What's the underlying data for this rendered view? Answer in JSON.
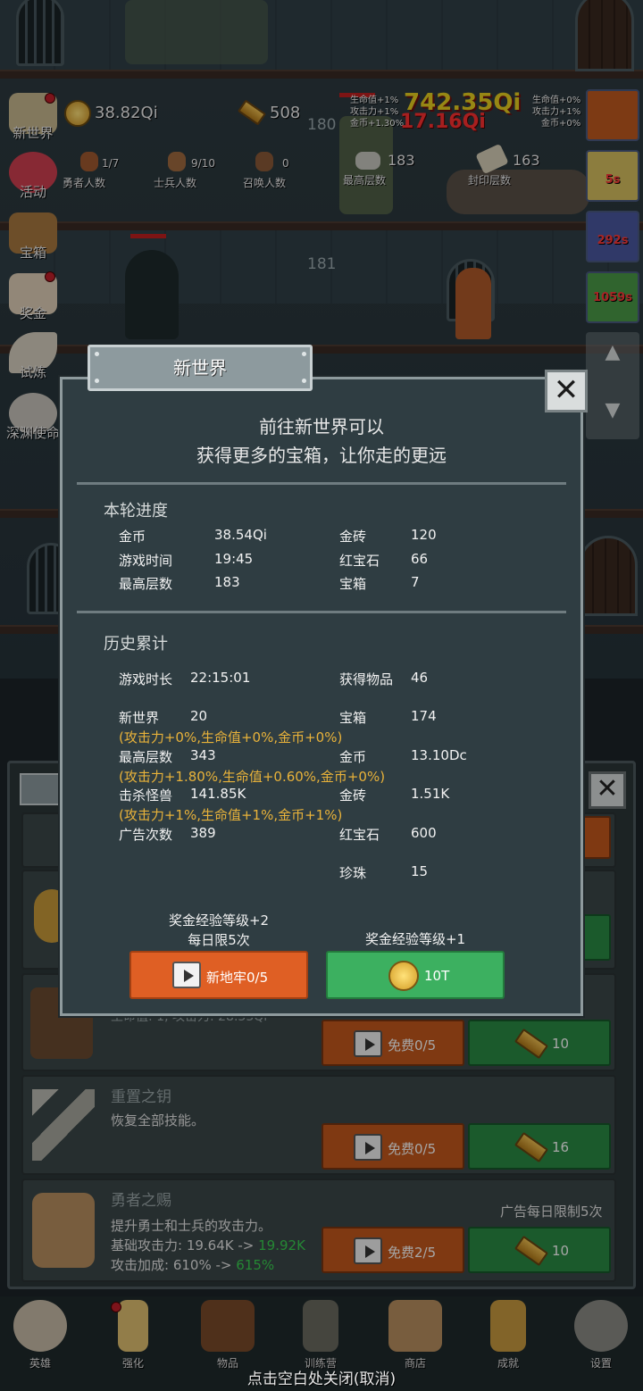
{
  "top": {
    "gold": "38.82Qi",
    "gold_bars": "508",
    "lane_numbers": [
      "180",
      "181"
    ],
    "counts": [
      {
        "value": "1/7",
        "label": "勇者人数"
      },
      {
        "value": "9/10",
        "label": "士兵人数"
      },
      {
        "value": "0",
        "label": "召唤人数"
      },
      {
        "value": "183",
        "label": "最高层数"
      },
      {
        "value": "163",
        "label": "封印层数"
      }
    ],
    "buff_left": [
      "生命值+1%",
      "攻击力+1%",
      "金币+1.30%"
    ],
    "buff_right": [
      "生命值+0%",
      "攻击力+1%",
      "金币+0%"
    ],
    "damage_popups": [
      "742.35Qi",
      "17.16Qi"
    ]
  },
  "side_menu": [
    "新世界",
    "活动",
    "宝箱",
    "奖金",
    "试炼",
    "深渊使命"
  ],
  "buff_timers": [
    "5s",
    "292s",
    "1059s"
  ],
  "modal": {
    "tab_title": "新世界",
    "close_label": "✕",
    "intro_line1": "前往新世界可以",
    "intro_line2": "获得更多的宝箱，让你走的更远",
    "current": {
      "title": "本轮进度",
      "rows": [
        {
          "k1": "金币",
          "v1": "38.54Qi",
          "k2": "金砖",
          "v2": "120"
        },
        {
          "k1": "游戏时间",
          "v1": "19:45",
          "k2": "红宝石",
          "v2": "66"
        },
        {
          "k1": "最高层数",
          "v1": "183",
          "k2": "宝箱",
          "v2": "7"
        }
      ]
    },
    "history": {
      "title": "历史累计",
      "play_time_label": "游戏时长",
      "play_time": "22:15:01",
      "items_label": "获得物品",
      "items": "46",
      "new_world_label": "新世界",
      "new_world": "20",
      "new_world_bonus": "(攻击力+0%,生命值+0%,金币+0%)",
      "chest_label": "宝箱",
      "chest": "174",
      "max_floor_label": "最高层数",
      "max_floor": "343",
      "max_floor_bonus": "(攻击力+1.80%,生命值+0.60%,金币+0%)",
      "gold_label": "金币",
      "gold": "13.10Dc",
      "kills_label": "击杀怪兽",
      "kills": "141.85K",
      "kills_bonus": "(攻击力+1%,生命值+1%,金币+1%)",
      "bars_label": "金砖",
      "bars": "1.51K",
      "ads_label": "广告次数",
      "ads": "389",
      "ruby_label": "红宝石",
      "ruby": "600",
      "pearl_label": "珍珠",
      "pearl": "15"
    },
    "left_caption1": "奖金经验等级+2",
    "left_caption2": "每日限5次",
    "right_caption": "奖金经验等级+1",
    "btn_ad_label": "新地牢0/5",
    "btn_coin_label": "10T"
  },
  "store": {
    "partial_stats": "生命值: 1, 攻击力: 28.33Qi",
    "cards": [
      {
        "title": "重置之钥",
        "desc": "恢复全部技能。",
        "free": "免费0/5",
        "cost": "16"
      },
      {
        "title": "勇者之赐",
        "desc": "提升勇士和士兵的攻击力。",
        "line2_label": "基础攻击力: 19.64K -> ",
        "line2_new": "19.92K",
        "line3_label": "攻击加成: 610% -> ",
        "line3_new": "615%",
        "free": "免费2/5",
        "cost": "10",
        "limit": "广告每日限制5次"
      }
    ],
    "row3_free": "免费0/5",
    "row3_cost": "10"
  },
  "nav": [
    "英雄",
    "强化",
    "物品",
    "训练营",
    "商店",
    "成就",
    "设置"
  ],
  "footer_hint": "点击空白处关闭(取消)"
}
